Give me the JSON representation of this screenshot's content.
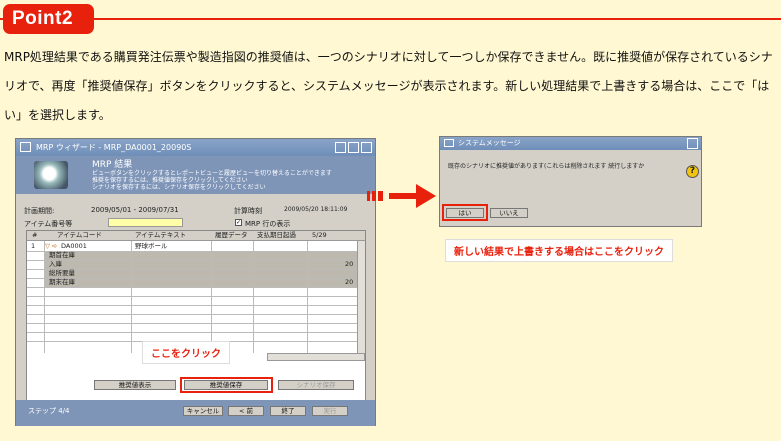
{
  "point_badge": "Point2",
  "intro_text": "MRP処理結果である購買発注伝票や製造指図の推奨値は、一つのシナリオに対して一つしか保存できません。既に推奨値が保存されているシナリオで、再度「推奨値保存」ボタンをクリックすると、システムメッセージが表示されます。新しい処理結果で上書きする場合は、ここで「はい」を選択します。",
  "wizard": {
    "title": "MRP ウィザード - MRP_DA0001_20090S",
    "header_title": "MRP 結果",
    "header_lines": [
      "ビューボタンをクリックするとレポートビューと履歴ビューを切り替えることができます",
      "推奨を保存するには、推奨値保存をクリックしてください",
      "シナリオを保存するには、シナリオ保存をクリックしてください"
    ],
    "period_label": "計画期間:",
    "period_value": "2009/05/01 - 2009/07/31",
    "timestamp_label": "計算時刻",
    "timestamp_value": "2009/05/20 18:11:09",
    "item_no_label": "アイテム番号等",
    "mrp_checkbox_label": "MRP 行の表示",
    "columns": [
      "#",
      "アイテムコード",
      "アイテムテキスト",
      "履歴データ",
      "支払期日起過",
      "5/29"
    ],
    "rows": [
      {
        "num": "1",
        "code": "DA0001",
        "text": "野球ボール",
        "value": ""
      },
      {
        "num": "",
        "code": "期首在庫",
        "text": "",
        "value": ""
      },
      {
        "num": "",
        "code": "入庫",
        "text": "",
        "value": "20"
      },
      {
        "num": "",
        "code": "総所要量",
        "text": "",
        "value": ""
      },
      {
        "num": "",
        "code": "期末在庫",
        "text": "",
        "value": "20"
      }
    ],
    "buttons": {
      "view": "推奨値表示",
      "save_recommend": "推奨値保存",
      "save_scenario": "シナリオ保存",
      "cancel": "キャンセル",
      "back": "< 前",
      "finish": "終了",
      "run": "実行"
    },
    "step": "ステップ 4/4",
    "click_here_note": "ここをクリック"
  },
  "dialog": {
    "title": "システムメッセージ",
    "message": "既存のシナリオに推奨値があります(これらは削除されます 続行しますか",
    "yes": "はい",
    "no": "いいえ"
  },
  "overwrite_note": "新しい結果で上書きする場合はここをクリック"
}
